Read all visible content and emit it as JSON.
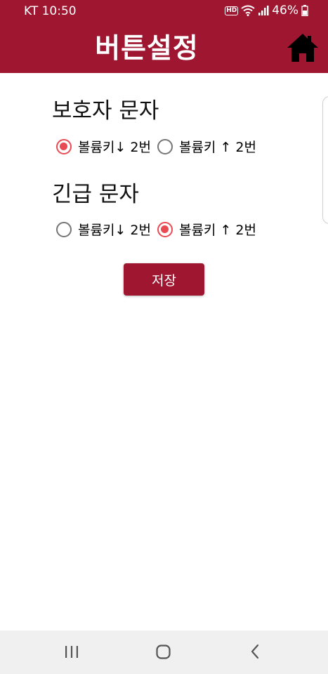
{
  "status_bar": {
    "carrier_time": "KT 10:50",
    "hd_badge": "HD",
    "battery": "46%"
  },
  "header": {
    "title": "버튼설정",
    "home_icon": "home-icon",
    "background_color": "#9f1631"
  },
  "guardian_sms": {
    "title": "보호자 문자",
    "options": [
      {
        "label": "볼륨키↓ 2번",
        "checked": true
      },
      {
        "label": "볼륨키 ↑ 2번",
        "checked": false
      }
    ]
  },
  "emergency_sms": {
    "title": "긴급 문자",
    "options": [
      {
        "label": "볼륨키↓ 2번",
        "checked": false
      },
      {
        "label": "볼륨키 ↑ 2번",
        "checked": true
      }
    ]
  },
  "save_button": {
    "label": "저장"
  },
  "accent_color": "#e94b55",
  "nav_bar": {
    "recents_icon": "recents-icon",
    "home_icon": "home-circle-icon",
    "back_icon": "back-icon"
  }
}
